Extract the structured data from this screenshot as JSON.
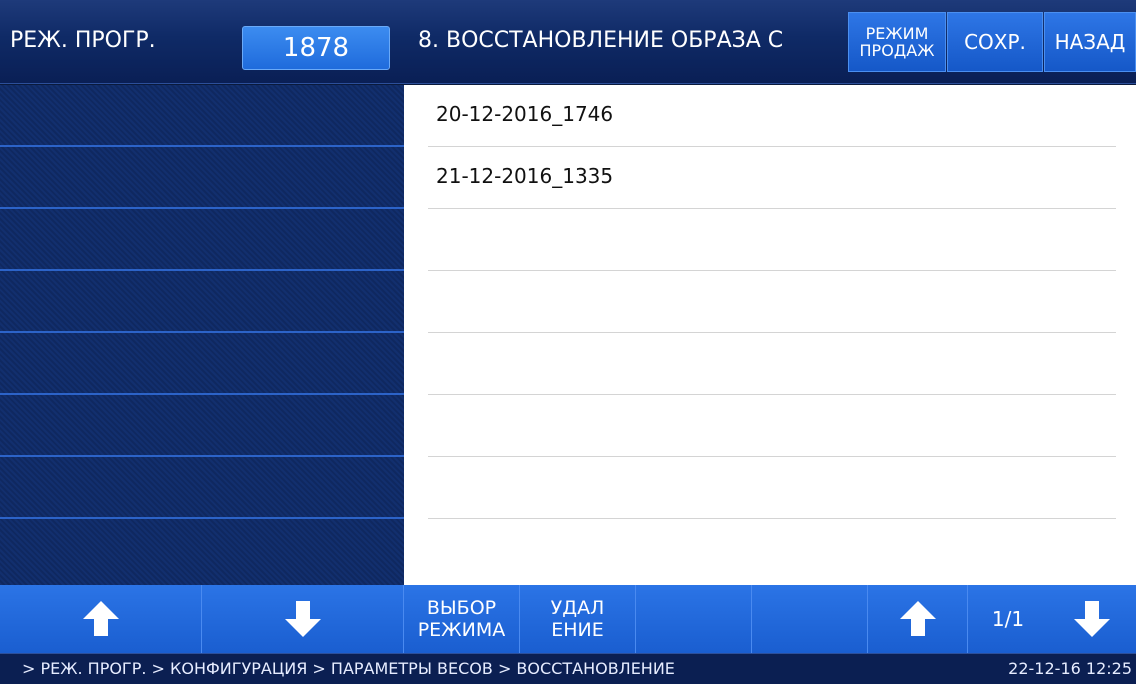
{
  "header": {
    "mode_title": "РЕЖ. ПРОГР.",
    "code": "1878",
    "screen_title": "8. ВОССТАНОВЛЕНИЕ ОБРАЗА С",
    "sales_mode_line1": "РЕЖИМ",
    "sales_mode_line2": "ПРОДАЖ",
    "save_label": "СОХР.",
    "back_label": "НАЗАД"
  },
  "list": {
    "items": [
      "20-12-2016_1746",
      "21-12-2016_1335",
      "",
      "",
      "",
      "",
      "",
      ""
    ]
  },
  "toolbar": {
    "left_up_icon": "arrow-up-icon",
    "left_down_icon": "arrow-down-icon",
    "select_mode_line1": "ВЫБОР",
    "select_mode_line2": "РЕЖИМА",
    "delete_line1": "УДАЛ",
    "delete_line2": "ЕНИЕ",
    "page_indicator": "1/1"
  },
  "status": {
    "breadcrumb": "> РЕЖ. ПРОГР. > КОНФИГУРАЦИЯ > ПАРАМЕТРЫ ВЕСОВ > ВОССТАНОВЛЕНИЕ",
    "datetime": "22-12-16 12:25"
  },
  "colors": {
    "header_bg": "#0f2a66",
    "button_blue": "#1f6bdc",
    "list_bg": "#ffffff"
  }
}
